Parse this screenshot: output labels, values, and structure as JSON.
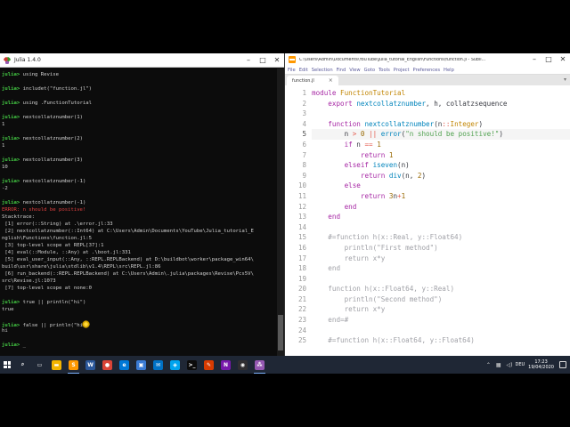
{
  "julia": {
    "title": "Julia 1.4.0",
    "lines": [
      {
        "t": "prompt",
        "p": "julia>",
        "c": " using Revise"
      },
      {
        "t": "blank"
      },
      {
        "t": "prompt",
        "p": "julia>",
        "c": " includet(\"function.jl\")"
      },
      {
        "t": "blank"
      },
      {
        "t": "prompt",
        "p": "julia>",
        "c": " using .FunctionTutorial"
      },
      {
        "t": "blank"
      },
      {
        "t": "prompt",
        "p": "julia>",
        "c": " nextcollatznumber(1)"
      },
      {
        "t": "out",
        "c": "1"
      },
      {
        "t": "blank"
      },
      {
        "t": "prompt",
        "p": "julia>",
        "c": " nextcollatznumber(2)"
      },
      {
        "t": "out",
        "c": "1"
      },
      {
        "t": "blank"
      },
      {
        "t": "prompt",
        "p": "julia>",
        "c": " nextcollatznumber(3)"
      },
      {
        "t": "out",
        "c": "10"
      },
      {
        "t": "blank"
      },
      {
        "t": "prompt",
        "p": "julia>",
        "c": " nextcollatznumber(-1)"
      },
      {
        "t": "out",
        "c": "-2"
      },
      {
        "t": "blank"
      },
      {
        "t": "prompt",
        "p": "julia>",
        "c": " nextcollatznumber(-1)"
      },
      {
        "t": "err",
        "c": "ERROR: n should be positive!"
      },
      {
        "t": "out",
        "c": "Stacktrace:"
      },
      {
        "t": "out",
        "c": " [1] error(::String) at .\\error.jl:33"
      },
      {
        "t": "out",
        "c": " [2] nextcollatznumber(::Int64) at C:\\Users\\Admin\\Documents\\YouTube\\Julia_tutorial_E"
      },
      {
        "t": "out",
        "c": "nglish\\Functions\\function.jl:5"
      },
      {
        "t": "out",
        "c": " [3] top-level scope at REPL[37]:1"
      },
      {
        "t": "out",
        "c": " [4] eval(::Module, ::Any) at .\\boot.jl:331"
      },
      {
        "t": "out",
        "c": " [5] eval_user_input(::Any, ::REPL.REPLBackend) at D:\\buildbot\\worker\\package_win64\\"
      },
      {
        "t": "out",
        "c": "build\\usr\\share\\julia\\stdlib\\v1.4\\REPL\\src\\REPL.jl:86"
      },
      {
        "t": "out",
        "c": " [6] run_backend(::REPL.REPLBackend) at C:\\Users\\Admin\\.julia\\packages\\Revise\\Pcs5V\\"
      },
      {
        "t": "out",
        "c": "src\\Revise.jl:1073"
      },
      {
        "t": "out",
        "c": " [7] top-level scope at none:0"
      },
      {
        "t": "blank"
      },
      {
        "t": "prompt",
        "p": "julia>",
        "c": " true || println(\"hi\")"
      },
      {
        "t": "out",
        "c": "true"
      },
      {
        "t": "blank"
      },
      {
        "t": "prompt",
        "p": "julia>",
        "c": " false || println(\"hi\")",
        "cursor": true
      },
      {
        "t": "out",
        "c": "hi"
      },
      {
        "t": "blank"
      },
      {
        "t": "prompt",
        "p": "julia>",
        "c": " _"
      }
    ]
  },
  "sublime": {
    "title": "C:\\Users\\Admin\\Documents\\YouTube\\Julia_tutorial_English\\Functions\\function.jl - Subli...",
    "menu": [
      "File",
      "Edit",
      "Selection",
      "Find",
      "View",
      "Goto",
      "Tools",
      "Project",
      "Preferences",
      "Help"
    ],
    "tab": "function.jl",
    "line_numbers": [
      "1",
      "2",
      "3",
      "4",
      "5",
      "6",
      "7",
      "8",
      "9",
      "10",
      "11",
      "12",
      "13",
      "14",
      "15",
      "16",
      "17",
      "18",
      "19",
      "20",
      "21",
      "22",
      "23",
      "24",
      "25"
    ],
    "active_line": 5,
    "code": [
      [
        [
          "kw",
          "module "
        ],
        [
          "ty",
          "FunctionTutorial"
        ]
      ],
      [
        [
          "id",
          "    "
        ],
        [
          "kw",
          "export "
        ],
        [
          "fn",
          "nextcollatznumber"
        ],
        [
          "id",
          ", h, collatzsequence"
        ]
      ],
      [],
      [
        [
          "id",
          "    "
        ],
        [
          "kw",
          "function "
        ],
        [
          "fn",
          "nextcollatznumber"
        ],
        [
          "id",
          "(n"
        ],
        [
          "op",
          "::"
        ],
        [
          "ty",
          "Integer"
        ],
        [
          "id",
          ")"
        ]
      ],
      [
        [
          "id",
          "        n "
        ],
        [
          "op",
          ">"
        ],
        [
          "id",
          " "
        ],
        [
          "num",
          "0"
        ],
        [
          "id",
          " "
        ],
        [
          "op",
          "||"
        ],
        [
          "id",
          " "
        ],
        [
          "fn",
          "error"
        ],
        [
          "id",
          "("
        ],
        [
          "str",
          "\"n should be positive!\""
        ],
        [
          "id",
          ")"
        ]
      ],
      [
        [
          "id",
          "        "
        ],
        [
          "kw",
          "if "
        ],
        [
          "id",
          "n "
        ],
        [
          "op",
          "=="
        ],
        [
          "id",
          " "
        ],
        [
          "num",
          "1"
        ]
      ],
      [
        [
          "id",
          "            "
        ],
        [
          "kw",
          "return "
        ],
        [
          "num",
          "1"
        ]
      ],
      [
        [
          "id",
          "        "
        ],
        [
          "kw",
          "elseif "
        ],
        [
          "fn",
          "iseven"
        ],
        [
          "id",
          "(n)"
        ]
      ],
      [
        [
          "id",
          "            "
        ],
        [
          "kw",
          "return "
        ],
        [
          "fn",
          "div"
        ],
        [
          "id",
          "(n, "
        ],
        [
          "num",
          "2"
        ],
        [
          "id",
          ")"
        ]
      ],
      [
        [
          "id",
          "        "
        ],
        [
          "kw",
          "else"
        ]
      ],
      [
        [
          "id",
          "            "
        ],
        [
          "kw",
          "return "
        ],
        [
          "num",
          "3"
        ],
        [
          "id",
          "n"
        ],
        [
          "op",
          "+"
        ],
        [
          "num",
          "1"
        ]
      ],
      [
        [
          "id",
          "        "
        ],
        [
          "kw",
          "end"
        ]
      ],
      [
        [
          "id",
          "    "
        ],
        [
          "kw",
          "end"
        ]
      ],
      [],
      [
        [
          "id",
          "    "
        ],
        [
          "cm",
          "#=function h(x::Real, y::Float64)"
        ]
      ],
      [
        [
          "id",
          "        "
        ],
        [
          "cm",
          "println(\"First method\")"
        ]
      ],
      [
        [
          "id",
          "        "
        ],
        [
          "cm",
          "return x*y"
        ]
      ],
      [
        [
          "id",
          "    "
        ],
        [
          "cm",
          "end"
        ]
      ],
      [],
      [
        [
          "id",
          "    "
        ],
        [
          "cm",
          "function h(x::Float64, y::Real)"
        ]
      ],
      [
        [
          "id",
          "        "
        ],
        [
          "cm",
          "println(\"Second method\")"
        ]
      ],
      [
        [
          "id",
          "        "
        ],
        [
          "cm",
          "return x*y"
        ]
      ],
      [
        [
          "id",
          "    "
        ],
        [
          "cm",
          "end=#"
        ]
      ],
      [],
      [
        [
          "id",
          "    "
        ],
        [
          "cm",
          "#=function h(x::Float64, y::Float64)"
        ]
      ]
    ]
  },
  "taskbar": {
    "icons": [
      {
        "name": "search-icon",
        "label": "⌕",
        "color": "#1f2735"
      },
      {
        "name": "task-view-icon",
        "label": "▭",
        "color": "#1f2735"
      },
      {
        "name": "file-explorer-icon",
        "label": "▬",
        "color": "#f4b400"
      },
      {
        "name": "sublime-icon",
        "label": "S",
        "color": "#ff9800",
        "active": true
      },
      {
        "name": "word-icon",
        "label": "W",
        "color": "#2b579a"
      },
      {
        "name": "chrome-icon",
        "label": "●",
        "color": "#db4437"
      },
      {
        "name": "edge-icon",
        "label": "e",
        "color": "#0078d7"
      },
      {
        "name": "photos-icon",
        "label": "▣",
        "color": "#3a7bd5"
      },
      {
        "name": "mail-icon",
        "label": "✉",
        "color": "#0072c6"
      },
      {
        "name": "store-icon",
        "label": "◈",
        "color": "#00a4ef"
      },
      {
        "name": "terminal-icon",
        "label": ">_",
        "color": "#0c0c0c"
      },
      {
        "name": "paint-icon",
        "label": "✎",
        "color": "#d83b01"
      },
      {
        "name": "onenote-icon",
        "label": "N",
        "color": "#7719aa"
      },
      {
        "name": "obs-icon",
        "label": "◉",
        "color": "#302e31"
      },
      {
        "name": "julia-icon",
        "label": "⁂",
        "color": "#9558b2",
        "active": true
      }
    ],
    "language": "DEU",
    "time": "17:23",
    "date": "19/04/2020"
  }
}
